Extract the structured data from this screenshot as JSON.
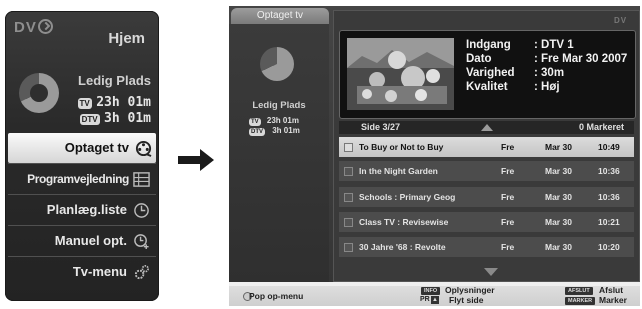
{
  "left_panel": {
    "logo": "DV",
    "title": "Hjem",
    "space_label": "Ledig Plads",
    "rows": [
      {
        "badge": "TV",
        "time": "23h 01m"
      },
      {
        "badge": "DTV",
        "time": "3h 01m"
      }
    ],
    "menu": [
      {
        "label": "Optaget tv",
        "icon": "film-reel-icon",
        "selected": true
      },
      {
        "label": "Programvejledning",
        "icon": "guide-grid-icon",
        "selected": false
      },
      {
        "label": "Planlæg.liste",
        "icon": "clock-icon",
        "selected": false
      },
      {
        "label": "Manuel opt.",
        "icon": "clock-plus-icon",
        "selected": false
      },
      {
        "label": "Tv-menu",
        "icon": "gears-icon",
        "selected": false
      }
    ]
  },
  "right_panel": {
    "tab": "Optaget tv",
    "logo": "DV",
    "space_label": "Ledig Plads",
    "rows": [
      {
        "badge": "TV",
        "time": "23h 01m"
      },
      {
        "badge": "DTV",
        "time": "3h 01m"
      }
    ],
    "info": {
      "labels": [
        "Indgang",
        "Dato",
        "Varighed",
        "Kvalitet"
      ],
      "values": [
        ": DTV 1",
        ": Fre Mar 30 2007",
        ": 30m",
        ": Høj"
      ]
    },
    "page": "Side  3/27",
    "marked": "0 Markeret",
    "recordings": [
      {
        "title": "To Buy or Not to Buy",
        "day": "Fre",
        "date": "Mar 30",
        "time": "10:49",
        "selected": true
      },
      {
        "title": "In the Night Garden",
        "day": "Fre",
        "date": "Mar 30",
        "time": "10:36",
        "selected": false
      },
      {
        "title": "Schools : Primary Geog",
        "day": "Fre",
        "date": "Mar 30",
        "time": "10:36",
        "selected": false
      },
      {
        "title": "Class TV : Revisewise",
        "day": "Fre",
        "date": "Mar 30",
        "time": "10:21",
        "selected": false
      },
      {
        "title": "30 Jahre '68 : Revolte",
        "day": "Fre",
        "date": "Mar 30",
        "time": "10:20",
        "selected": false
      }
    ],
    "footer": {
      "popup": "Pop op-menu",
      "info_badge": "INFO",
      "info_text": "Oplysninger",
      "pr_badge": "PR",
      "page_text": "Flyt side",
      "exit_badge": "AFSLUT",
      "exit_text": "Afslut",
      "mark_badge": "MARKER",
      "mark_text": "Marker"
    }
  }
}
